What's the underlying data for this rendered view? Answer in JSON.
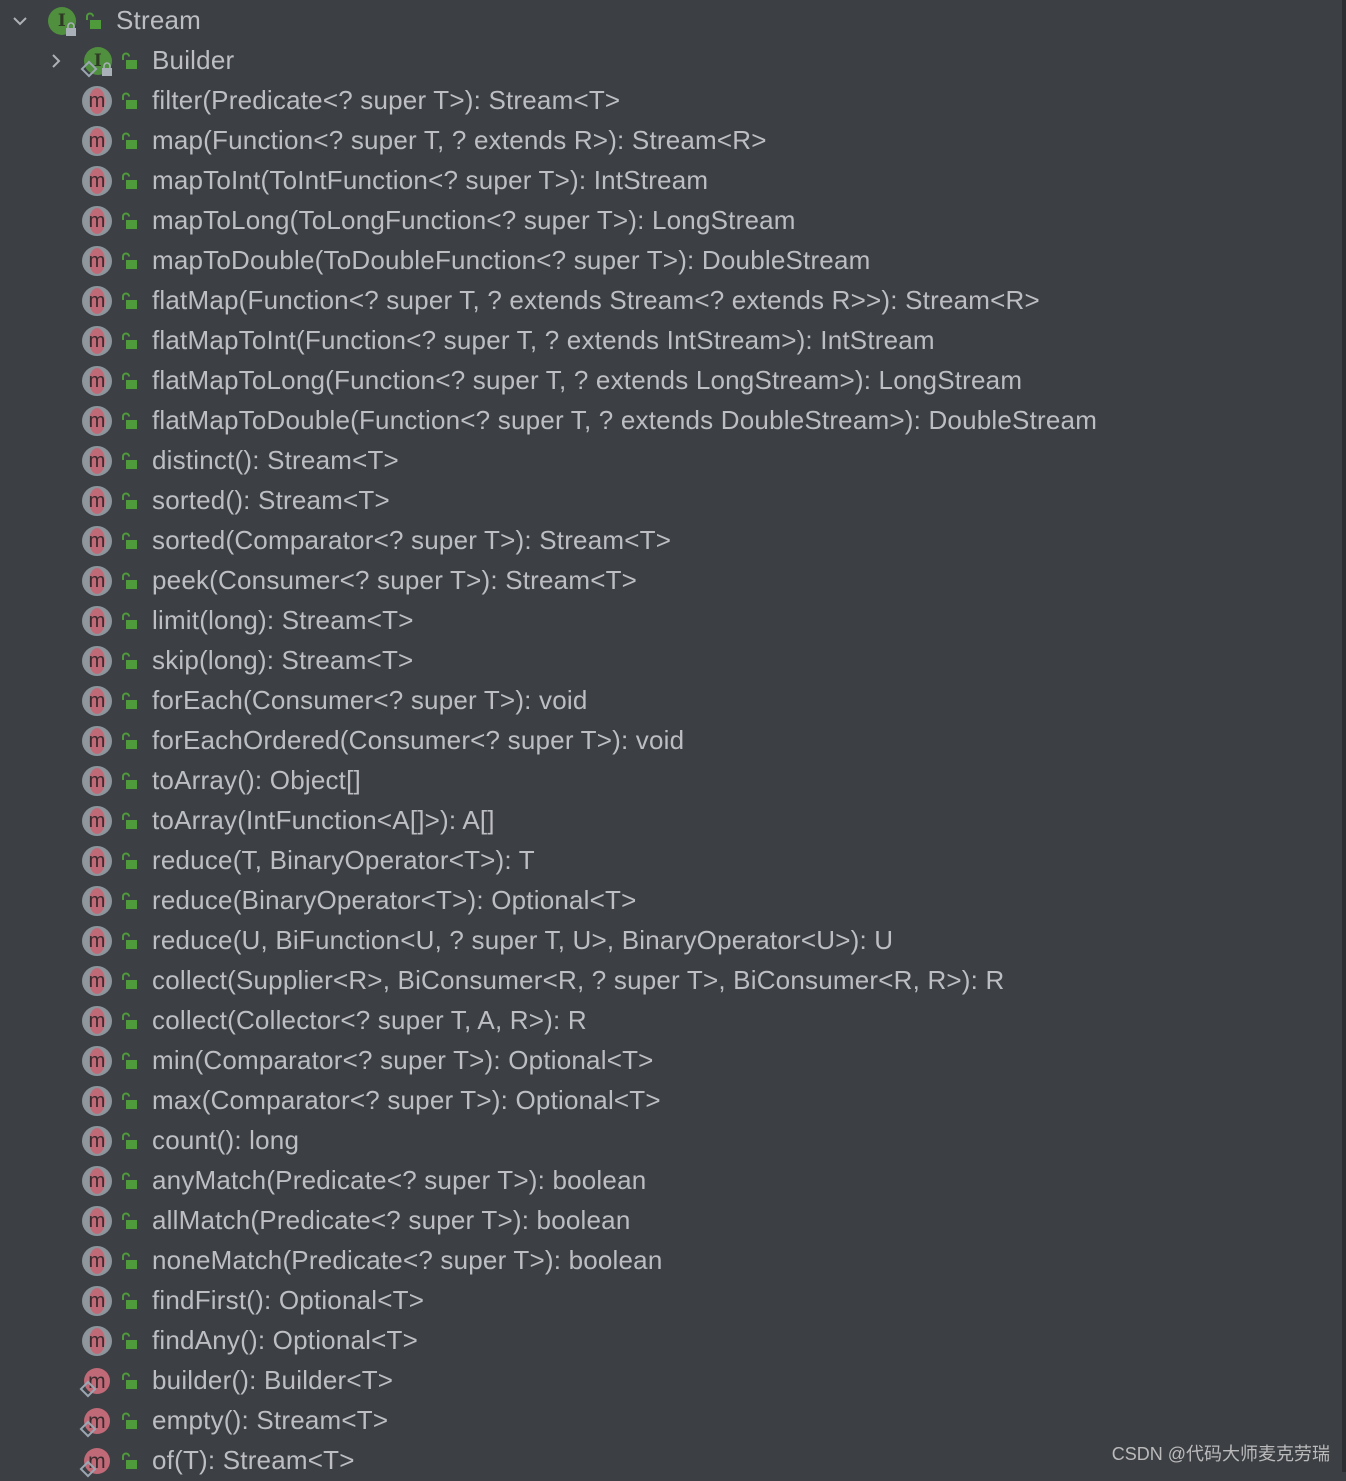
{
  "tree": {
    "root": {
      "label": "Stream",
      "kind": "interface",
      "expanded": true
    },
    "builder": {
      "label": "Builder",
      "kind": "nested-interface",
      "expanded": false
    },
    "methods": [
      {
        "label": "filter(Predicate<? super T>): Stream<T>",
        "kind": "abstract"
      },
      {
        "label": "map(Function<? super T, ? extends R>): Stream<R>",
        "kind": "abstract"
      },
      {
        "label": "mapToInt(ToIntFunction<? super T>): IntStream",
        "kind": "abstract"
      },
      {
        "label": "mapToLong(ToLongFunction<? super T>): LongStream",
        "kind": "abstract"
      },
      {
        "label": "mapToDouble(ToDoubleFunction<? super T>): DoubleStream",
        "kind": "abstract"
      },
      {
        "label": "flatMap(Function<? super T, ? extends Stream<? extends R>>): Stream<R>",
        "kind": "abstract"
      },
      {
        "label": "flatMapToInt(Function<? super T, ? extends IntStream>): IntStream",
        "kind": "abstract"
      },
      {
        "label": "flatMapToLong(Function<? super T, ? extends LongStream>): LongStream",
        "kind": "abstract"
      },
      {
        "label": "flatMapToDouble(Function<? super T, ? extends DoubleStream>): DoubleStream",
        "kind": "abstract"
      },
      {
        "label": "distinct(): Stream<T>",
        "kind": "abstract"
      },
      {
        "label": "sorted(): Stream<T>",
        "kind": "abstract"
      },
      {
        "label": "sorted(Comparator<? super T>): Stream<T>",
        "kind": "abstract"
      },
      {
        "label": "peek(Consumer<? super T>): Stream<T>",
        "kind": "abstract"
      },
      {
        "label": "limit(long): Stream<T>",
        "kind": "abstract"
      },
      {
        "label": "skip(long): Stream<T>",
        "kind": "abstract"
      },
      {
        "label": "forEach(Consumer<? super T>): void",
        "kind": "abstract"
      },
      {
        "label": "forEachOrdered(Consumer<? super T>): void",
        "kind": "abstract"
      },
      {
        "label": "toArray(): Object[]",
        "kind": "abstract"
      },
      {
        "label": "toArray(IntFunction<A[]>): A[]",
        "kind": "abstract"
      },
      {
        "label": "reduce(T, BinaryOperator<T>): T",
        "kind": "abstract"
      },
      {
        "label": "reduce(BinaryOperator<T>): Optional<T>",
        "kind": "abstract"
      },
      {
        "label": "reduce(U, BiFunction<U, ? super T, U>, BinaryOperator<U>): U",
        "kind": "abstract"
      },
      {
        "label": "collect(Supplier<R>, BiConsumer<R, ? super T>, BiConsumer<R, R>): R",
        "kind": "abstract"
      },
      {
        "label": "collect(Collector<? super T, A, R>): R",
        "kind": "abstract"
      },
      {
        "label": "min(Comparator<? super T>): Optional<T>",
        "kind": "abstract"
      },
      {
        "label": "max(Comparator<? super T>): Optional<T>",
        "kind": "abstract"
      },
      {
        "label": "count(): long",
        "kind": "abstract"
      },
      {
        "label": "anyMatch(Predicate<? super T>): boolean",
        "kind": "abstract"
      },
      {
        "label": "allMatch(Predicate<? super T>): boolean",
        "kind": "abstract"
      },
      {
        "label": "noneMatch(Predicate<? super T>): boolean",
        "kind": "abstract"
      },
      {
        "label": "findFirst(): Optional<T>",
        "kind": "abstract"
      },
      {
        "label": "findAny(): Optional<T>",
        "kind": "abstract"
      },
      {
        "label": "builder(): Builder<T>",
        "kind": "static"
      },
      {
        "label": "empty(): Stream<T>",
        "kind": "static"
      },
      {
        "label": "of(T): Stream<T>",
        "kind": "static"
      }
    ]
  },
  "icons": {
    "interface_letter": "I",
    "method_letter": "m"
  },
  "colors": {
    "background": "#3c3f43",
    "text": "#bcbec4",
    "interface": "#4f8f3e",
    "method": "#c06a78",
    "public": "#4f9a3b"
  },
  "watermark": "CSDN @代码大师麦克劳瑞"
}
